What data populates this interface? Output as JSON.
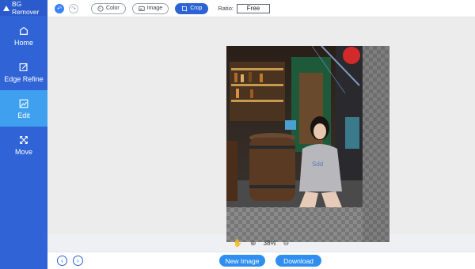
{
  "app": {
    "title": "BG Remover"
  },
  "sidebar": {
    "items": [
      {
        "label": "Home",
        "icon": "home-icon"
      },
      {
        "label": "Edge Refine",
        "icon": "edit-box-icon"
      },
      {
        "label": "Edit",
        "icon": "crop-edit-icon",
        "active": true
      },
      {
        "label": "Move",
        "icon": "move-arrows-icon"
      }
    ]
  },
  "toolbar": {
    "undo_icon": "undo-icon",
    "redo_icon": "redo-icon",
    "color_label": "Color",
    "image_label": "Image",
    "crop_label": "Crop",
    "ratio_label": "Ratio:",
    "ratio_value": "Free"
  },
  "zoom": {
    "level": "38%"
  },
  "actions": {
    "new_image": "New Image",
    "download": "Download"
  },
  "colors": {
    "sidebar": "#2f63d6",
    "active": "#3fa0f0",
    "button": "#2f8ff0"
  }
}
